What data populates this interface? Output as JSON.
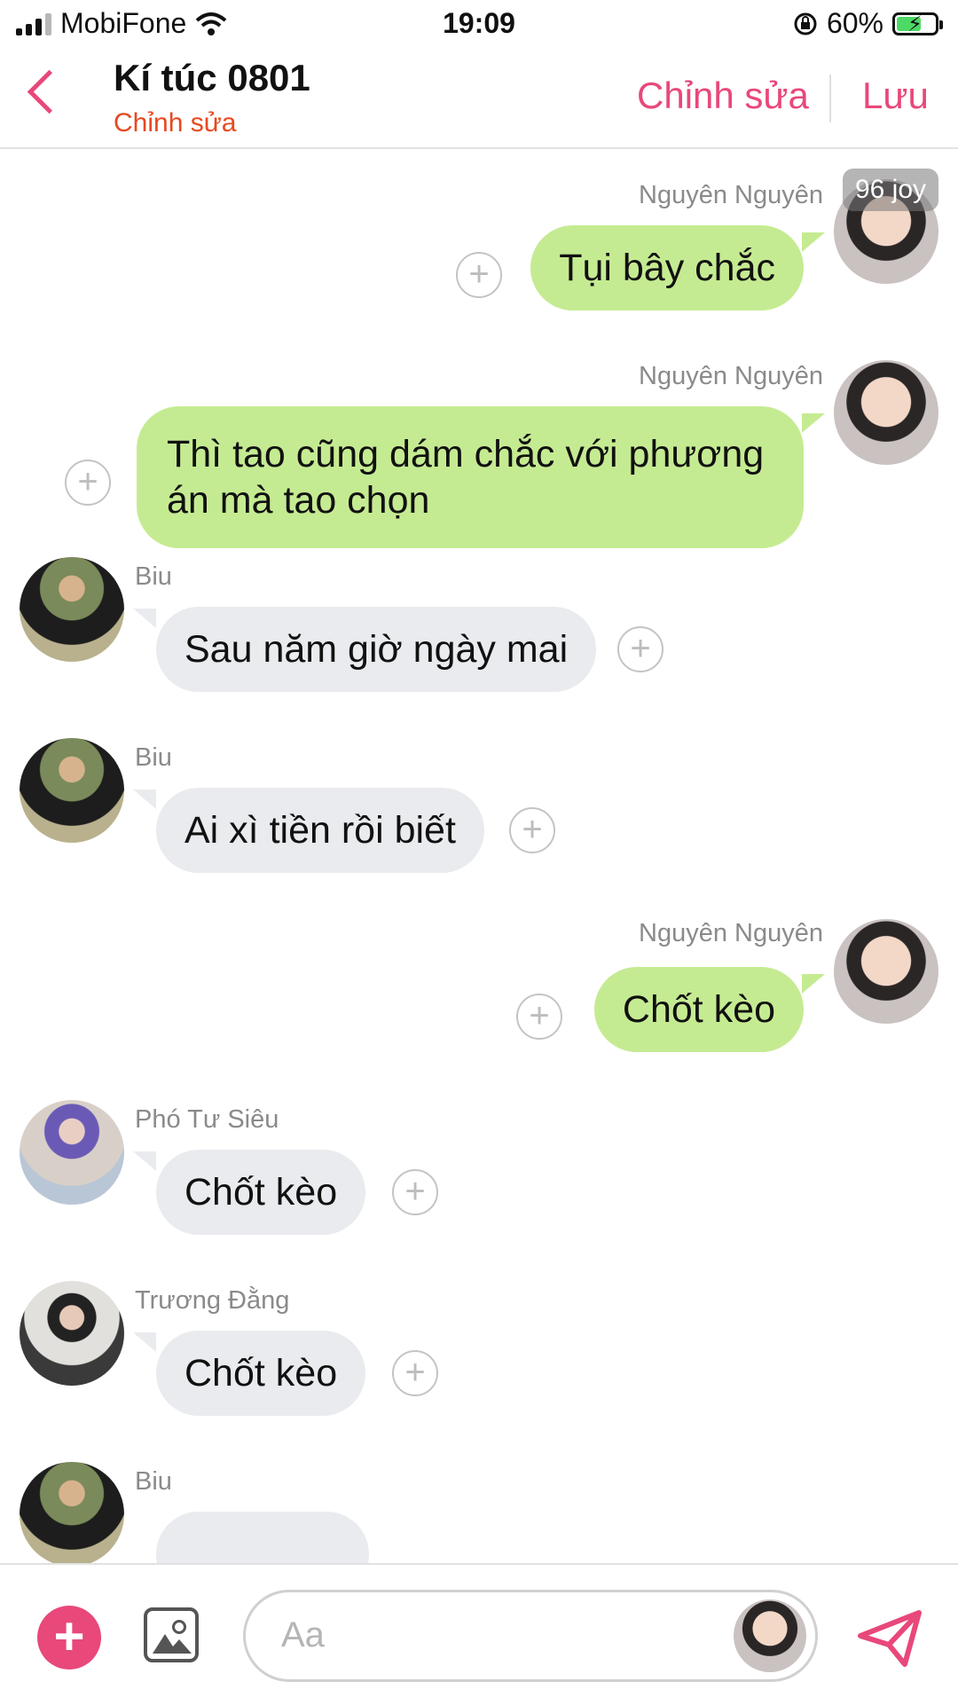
{
  "status_bar": {
    "carrier": "MobiFone",
    "time": "19:09",
    "battery": "60%"
  },
  "header": {
    "title": "Kí túc 0801",
    "subtitle": "Chỉnh sửa",
    "edit_label": "Chỉnh sửa",
    "save_label": "Lưu"
  },
  "badge": "96 joy",
  "messages": [
    {
      "sender": "Nguyên Nguyên",
      "text": "Tụi bây chắc",
      "side": "out"
    },
    {
      "sender": "Nguyên Nguyên",
      "text": "Thì tao cũng dám chắc với phương án mà tao chọn",
      "side": "out"
    },
    {
      "sender": "Biu",
      "text": "Sau năm giờ ngày mai",
      "side": "in"
    },
    {
      "sender": "Biu",
      "text": "Ai xì tiền rồi biết",
      "side": "in"
    },
    {
      "sender": "Nguyên Nguyên",
      "text": "Chốt kèo",
      "side": "out"
    },
    {
      "sender": "Phó Tư Siêu",
      "text": "Chốt kèo",
      "side": "in"
    },
    {
      "sender": "Trương Đằng",
      "text": "Chốt kèo",
      "side": "in"
    },
    {
      "sender": "Biu",
      "text": "",
      "side": "in"
    }
  ],
  "composer": {
    "placeholder": "Aa"
  },
  "colors": {
    "accent": "#e8487a",
    "outgoing_bubble": "#c5eb92",
    "incoming_bubble": "#e9ebee",
    "subtitle": "#e8481e"
  }
}
